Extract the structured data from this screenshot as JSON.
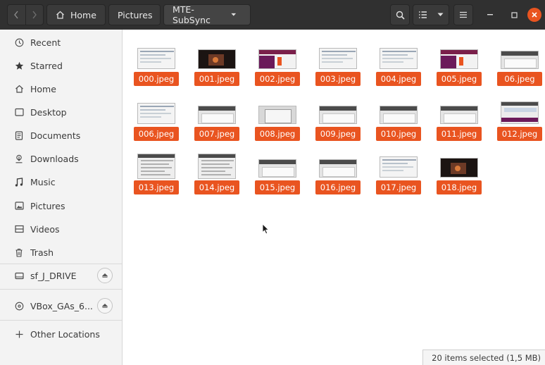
{
  "toolbar": {
    "path": [
      {
        "label": "Home",
        "icon": "home-icon"
      },
      {
        "label": "Pictures"
      },
      {
        "label": "MTE-SubSync",
        "icon": "chevron-down-icon"
      }
    ]
  },
  "sidebar": {
    "items": [
      {
        "label": "Recent",
        "icon": "clock-icon"
      },
      {
        "label": "Starred",
        "icon": "star-icon"
      },
      {
        "label": "Home",
        "icon": "home-icon"
      },
      {
        "label": "Desktop",
        "icon": "desktop-icon"
      },
      {
        "label": "Documents",
        "icon": "document-icon"
      },
      {
        "label": "Downloads",
        "icon": "download-icon"
      },
      {
        "label": "Music",
        "icon": "music-icon"
      },
      {
        "label": "Pictures",
        "icon": "picture-icon"
      },
      {
        "label": "Videos",
        "icon": "video-icon"
      },
      {
        "label": "Trash",
        "icon": "trash-icon"
      }
    ],
    "drives": [
      {
        "label": "sf_J_DRIVE",
        "icon": "drive-icon"
      },
      {
        "label": "VBox_GAs_6...",
        "icon": "disc-icon"
      }
    ],
    "other_locations": "Other Locations"
  },
  "files": [
    {
      "name": "000.jpeg",
      "style": "doc"
    },
    {
      "name": "001.jpeg",
      "style": "dark-video"
    },
    {
      "name": "002.jpeg",
      "style": "purple"
    },
    {
      "name": "003.jpeg",
      "style": "doc"
    },
    {
      "name": "004.jpeg",
      "style": "doc"
    },
    {
      "name": "005.jpeg",
      "style": "purple"
    },
    {
      "name": "06.jpeg",
      "style": "window"
    },
    {
      "name": "006.jpeg",
      "style": "doc"
    },
    {
      "name": "007.jpeg",
      "style": "window"
    },
    {
      "name": "008.jpeg",
      "style": "dialog"
    },
    {
      "name": "009.jpeg",
      "style": "window"
    },
    {
      "name": "010.jpeg",
      "style": "window"
    },
    {
      "name": "011.jpeg",
      "style": "window"
    },
    {
      "name": "012.jpeg",
      "style": "purple-window"
    },
    {
      "name": "013.jpeg",
      "style": "tall"
    },
    {
      "name": "014.jpeg",
      "style": "tall"
    },
    {
      "name": "015.jpeg",
      "style": "window"
    },
    {
      "name": "016.jpeg",
      "style": "window"
    },
    {
      "name": "017.jpeg",
      "style": "doc"
    },
    {
      "name": "018.jpeg",
      "style": "dark-video"
    }
  ],
  "status": {
    "text": "20 items selected (1,5 MB)"
  },
  "colors": {
    "accent": "#e95420",
    "header": "#303030",
    "sidebar": "#f3f3f3"
  }
}
